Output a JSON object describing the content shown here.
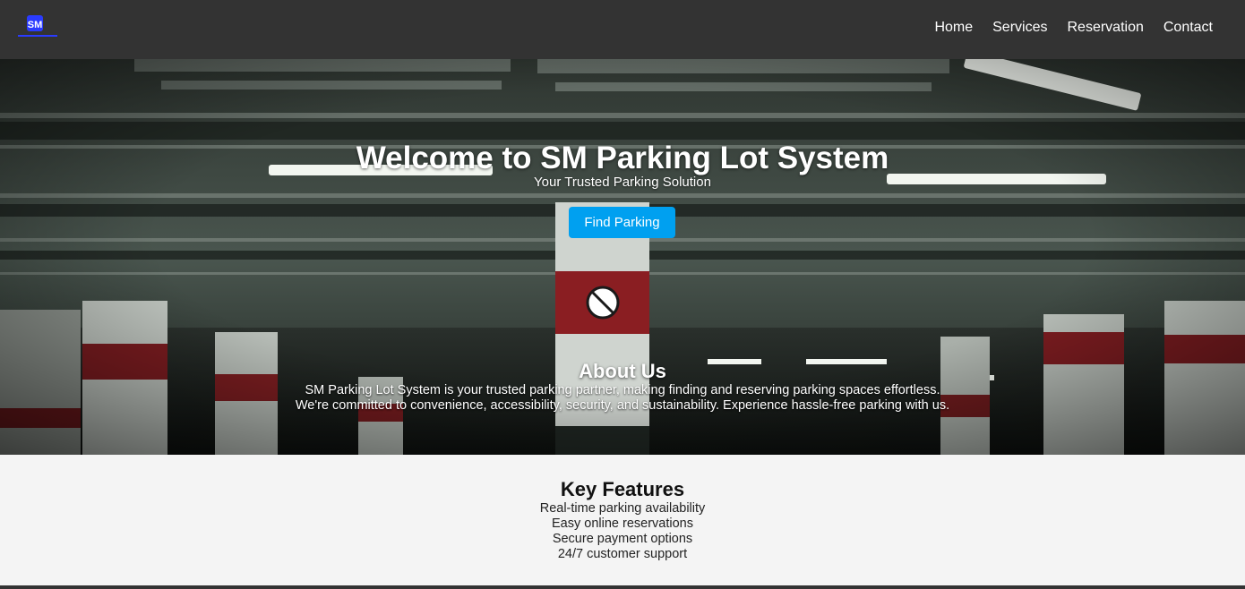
{
  "brand": {
    "logo_text": "SM",
    "logo_color": "#2a3bff"
  },
  "nav": {
    "items": [
      {
        "label": "Home"
      },
      {
        "label": "Services"
      },
      {
        "label": "Reservation"
      },
      {
        "label": "Contact"
      }
    ]
  },
  "hero": {
    "title": "Welcome to SM Parking Lot System",
    "subtitle": "Your Trusted Parking Solution",
    "cta_label": "Find Parking",
    "cta_color": "#00a0f0",
    "background_image": "underground-parking-garage"
  },
  "about": {
    "title": "About Us",
    "line1": "SM Parking Lot System is your trusted parking partner, making finding and reserving parking spaces effortless.",
    "line2": "We're committed to convenience, accessibility, security, and sustainability. Experience hassle-free parking with us."
  },
  "features": {
    "title": "Key Features",
    "items": [
      "Real-time parking availability",
      "Easy online reservations",
      "Secure payment options",
      "24/7 customer support"
    ]
  },
  "colors": {
    "navbar": "#333333",
    "page_bg": "#f4f4f4"
  }
}
